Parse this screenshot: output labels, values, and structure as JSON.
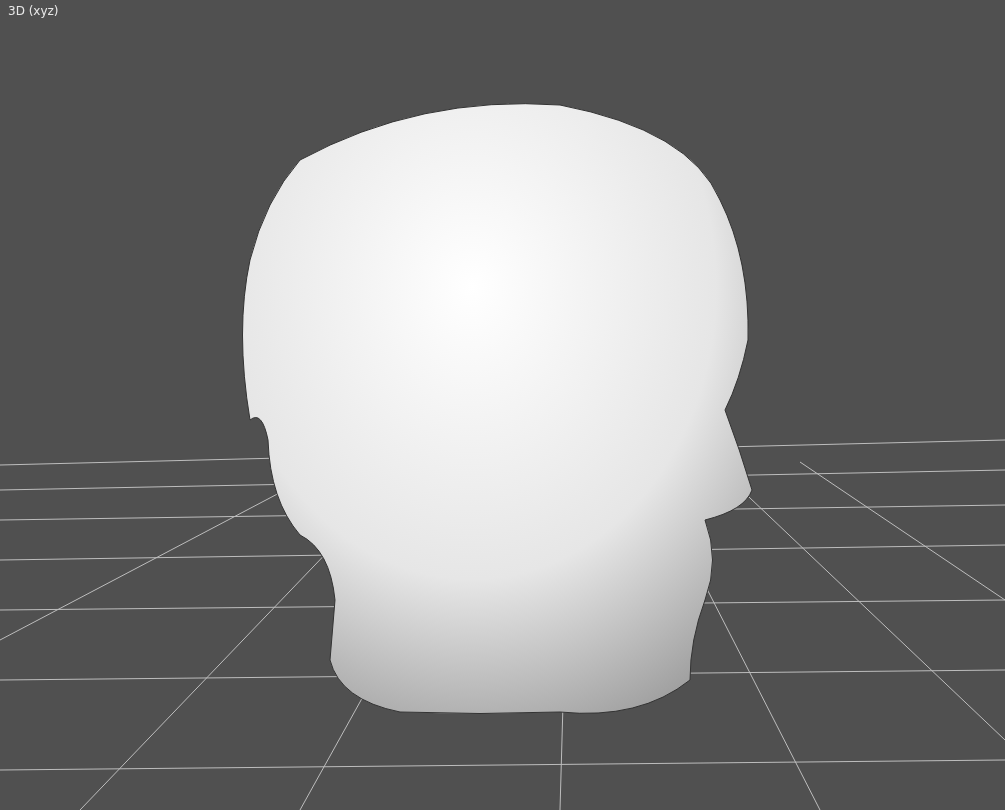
{
  "viewport": {
    "title": "3D (xyz)"
  }
}
